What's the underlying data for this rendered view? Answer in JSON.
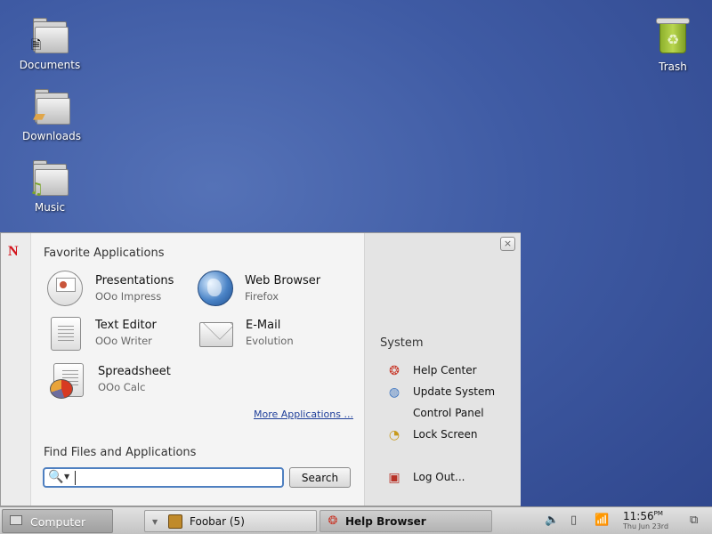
{
  "desktop": {
    "icons": [
      {
        "label": "Documents",
        "icon": "documents-folder-icon"
      },
      {
        "label": "Downloads",
        "icon": "downloads-folder-icon"
      },
      {
        "label": "Music",
        "icon": "music-folder-icon"
      },
      {
        "label": "Trash",
        "icon": "trash-icon"
      }
    ]
  },
  "menu": {
    "brand_logo": "N",
    "favorites": {
      "title": "Favorite Applications",
      "apps": [
        {
          "name": "Presentations",
          "sub": "OOo Impress",
          "icon": "impress-icon"
        },
        {
          "name": "Web Browser",
          "sub": "Firefox",
          "icon": "globe-icon"
        },
        {
          "name": "Text Editor",
          "sub": "OOo Writer",
          "icon": "writer-icon"
        },
        {
          "name": "E-Mail",
          "sub": "Evolution",
          "icon": "envelope-icon"
        },
        {
          "name": "Spreadsheet",
          "sub": "OOo Calc",
          "icon": "calc-icon"
        }
      ],
      "more_link": "More Applications ..."
    },
    "find": {
      "title": "Find Files and Applications",
      "placeholder": "",
      "value": "",
      "button": "Search"
    },
    "close_glyph": "×",
    "system": {
      "title": "System",
      "items": [
        {
          "label": "Help Center",
          "icon": "lifebuoy-icon"
        },
        {
          "label": "Update System",
          "icon": "update-icon"
        },
        {
          "label": "Control Panel",
          "icon": ""
        },
        {
          "label": "Lock Screen",
          "icon": "clock-lock-icon"
        },
        {
          "label": "Log Out...",
          "icon": "logout-icon"
        }
      ]
    }
  },
  "panel": {
    "computer": "Computer",
    "tasks": [
      {
        "label": "Foobar (5)",
        "icon": "window-group-icon"
      },
      {
        "label": "Help Browser",
        "icon": "lifebuoy-icon"
      }
    ],
    "clock": {
      "time": "11:56",
      "ampm": "PM",
      "date": "Thu Jun 23rd"
    }
  },
  "colors": {
    "desktop_bg": "#3f5ba4",
    "brand_red": "#d3131b",
    "link_blue": "#1f3f9a",
    "search_focus": "#4e7fc0"
  }
}
